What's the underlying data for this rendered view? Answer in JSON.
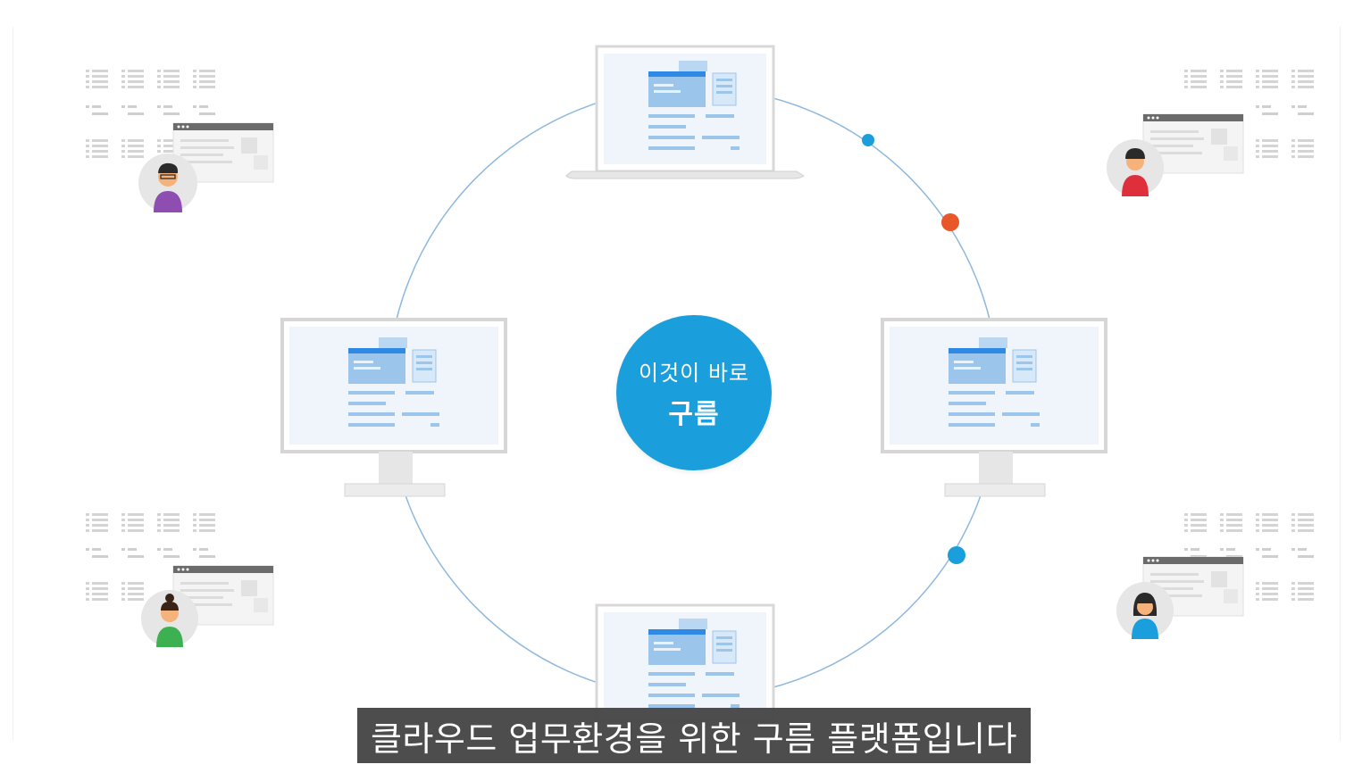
{
  "center": {
    "line1": "이것이 바로",
    "line2": "구름"
  },
  "subtitle": "클라우드 업무환경을 위한 구름 플랫폼입니다",
  "colors": {
    "accent_blue": "#1a9fdc",
    "dot_orange": "#e8572a",
    "ring": "#8fb8dc",
    "subtitle_bg": "#464646"
  },
  "icons": [
    "laptop-icon",
    "desktop-monitor-icon",
    "user-avatar-icon",
    "browser-window-icon",
    "document-list-icon"
  ]
}
